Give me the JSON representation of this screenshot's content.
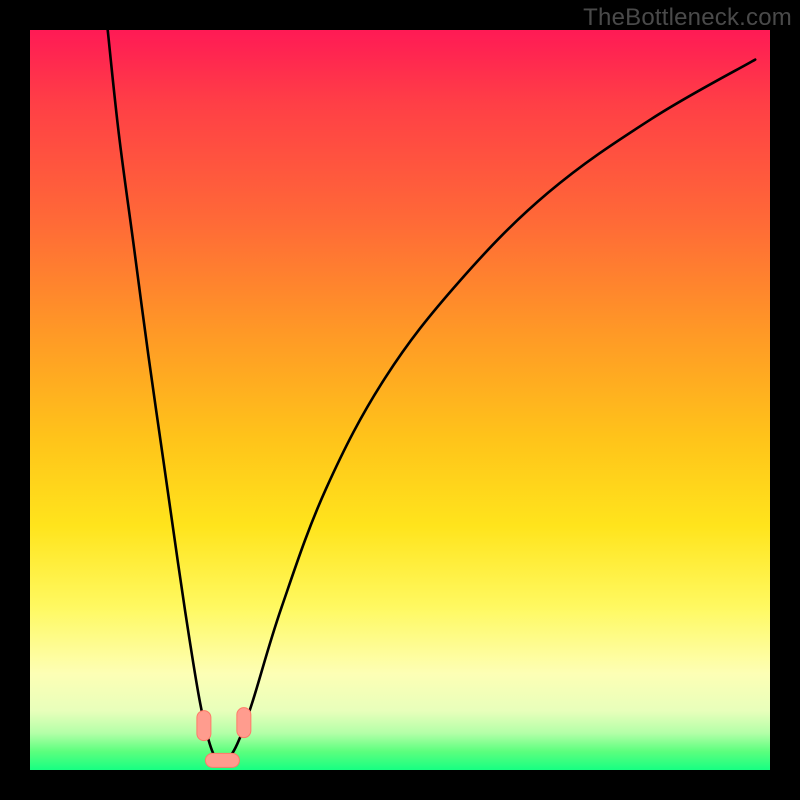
{
  "watermark": "TheBottleneck.com",
  "colors": {
    "frame": "#000000",
    "curve_stroke": "#000000",
    "marker_fill": "#ff9c8e",
    "marker_stroke": "#ff7a68",
    "gradient_stops": [
      {
        "offset": 0.0,
        "color": "#ff1a55"
      },
      {
        "offset": 0.1,
        "color": "#ff3f46"
      },
      {
        "offset": 0.26,
        "color": "#ff6a37"
      },
      {
        "offset": 0.41,
        "color": "#ff9926"
      },
      {
        "offset": 0.55,
        "color": "#ffc31a"
      },
      {
        "offset": 0.67,
        "color": "#ffe41c"
      },
      {
        "offset": 0.78,
        "color": "#fff961"
      },
      {
        "offset": 0.87,
        "color": "#fdffb5"
      },
      {
        "offset": 0.92,
        "color": "#e8ffbb"
      },
      {
        "offset": 0.95,
        "color": "#b4ffa8"
      },
      {
        "offset": 0.975,
        "color": "#5cff7e"
      },
      {
        "offset": 1.0,
        "color": "#17ff82"
      }
    ]
  },
  "chart_data": {
    "type": "line",
    "title": "",
    "xlabel": "",
    "ylabel": "",
    "xlim": [
      0,
      100
    ],
    "ylim": [
      0,
      100
    ],
    "grid": false,
    "legend": false,
    "series": [
      {
        "name": "bottleneck-curve",
        "x": [
          10.5,
          12,
          14,
          16,
          18,
          20,
          21.5,
          23,
          24.3,
          25.4,
          26.5,
          28,
          30,
          34,
          40,
          48,
          58,
          70,
          84,
          98
        ],
        "y": [
          100,
          86,
          71,
          56,
          42,
          28,
          18,
          9,
          3.5,
          1.3,
          1.3,
          3.5,
          9,
          22,
          38,
          53,
          66,
          78,
          88,
          96
        ]
      }
    ],
    "markers": [
      {
        "name": "marker-left",
        "x": 23.5,
        "y": 6.0,
        "shape": "capsule-vert"
      },
      {
        "name": "marker-right",
        "x": 28.9,
        "y": 6.4,
        "shape": "capsule-vert"
      },
      {
        "name": "marker-bottom",
        "x": 26.0,
        "y": 1.3,
        "shape": "capsule-horiz"
      }
    ],
    "annotations": []
  }
}
